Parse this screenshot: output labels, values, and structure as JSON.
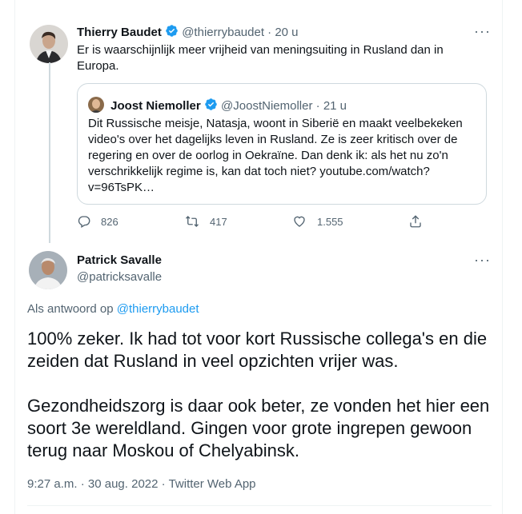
{
  "tweet1": {
    "author_name": "Thierry Baudet",
    "handle": "@thierrybaudet",
    "separator": "·",
    "time": "20 u",
    "text": "Er is waarschijnlijk meer vrijheid van meningsuiting in Rusland dan in Europa.",
    "quote": {
      "author_name": "Joost Niemoller",
      "handle": "@JoostNiemoller",
      "separator": "·",
      "time": "21 u",
      "text": "Dit Russische meisje, Natasja, woont in Siberië en maakt veelbekeken video's over het dagelijks leven in Rusland. Ze is zeer kritisch over de regering en over de oorlog in Oekraïne. Dan denk ik: als het nu zo'n verschrikkelijk regime is, kan dat toch niet? youtube.com/watch?v=96TsPK…"
    },
    "actions": {
      "replies": "826",
      "retweets": "417",
      "likes": "1.555"
    }
  },
  "tweet2": {
    "author_name": "Patrick Savalle",
    "handle": "@patricksavalle",
    "reply_prefix": "Als antwoord op",
    "reply_to": "@thierrybaudet",
    "paragraph1": "100% zeker. Ik had tot voor kort Russische collega's en die zeiden dat Rusland in veel opzichten vrijer was.",
    "paragraph2": "Gezondheidszorg is daar ook beter, ze vonden het hier een soort 3e wereldland. Gingen voor grote ingrepen gewoon terug naar Moskou of Chelyabinsk.",
    "time": "9:27 a.m.",
    "separator1": "·",
    "date": "30 aug. 2022",
    "separator2": "·",
    "source": "Twitter Web App"
  },
  "more_label": "···",
  "colors": {
    "accent": "#1d9bf0",
    "text": "#0f1419",
    "muted": "#536471",
    "border": "#cfd9de"
  },
  "icons": [
    "verified-badge-icon",
    "reply-icon",
    "retweet-icon",
    "like-icon",
    "share-icon",
    "more-icon"
  ]
}
